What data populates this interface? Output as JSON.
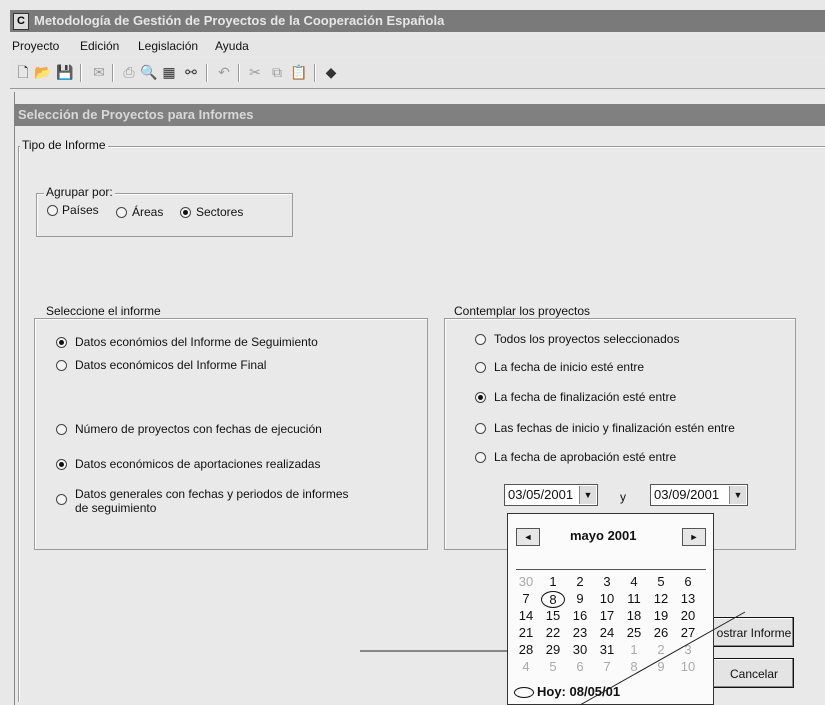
{
  "window": {
    "title": "Metodología de Gestión de Proyectos de la Cooperación Española",
    "icon": "app-icon-C"
  },
  "menu": [
    "Proyecto",
    "Edición",
    "Legislación",
    "Ayuda"
  ],
  "toolbar": {
    "icons": [
      "new-doc-icon",
      "open-folder-icon",
      "save-icon",
      "mail-icon",
      "print-icon",
      "print-preview-icon",
      "calendar-icon",
      "binoculars-icon",
      "undo-icon",
      "cut-icon",
      "copy-icon",
      "paste-icon",
      "book-icon"
    ]
  },
  "subwindow": {
    "title": "Selección de Proyectos para Informes"
  },
  "tipo": {
    "legend": "Tipo de Informe"
  },
  "agrupar": {
    "legend": "Agrupar por:",
    "options": [
      {
        "label": "Países",
        "checked": false
      },
      {
        "label": "Áreas",
        "checked": false
      },
      {
        "label": "Sectores",
        "checked": true
      }
    ]
  },
  "informe": {
    "legend": "Seleccione el informe",
    "options": [
      {
        "label": "Datos económios del Informe de Seguimiento",
        "checked": true
      },
      {
        "label": "Datos económicos del Informe Final",
        "checked": false
      },
      {
        "label": "Número de proyectos con fechas de ejecución",
        "checked": false
      },
      {
        "label": "Datos económicos de aportaciones realizadas",
        "checked": true
      },
      {
        "label": "Datos generales con fechas y periodos de informes",
        "label2": "de seguimiento",
        "checked": false
      }
    ]
  },
  "contemplar": {
    "legend": "Contemplar los proyectos",
    "options": [
      {
        "label": "Todos los proyectos seleccionados",
        "checked": false
      },
      {
        "label": "La fecha de inicio esté entre",
        "checked": false
      },
      {
        "label": "La fecha de finalización esté entre",
        "checked": true
      },
      {
        "label": "Las fechas de inicio y finalización estén entre",
        "checked": false
      },
      {
        "label": "La fecha de aprobación esté entre",
        "checked": false
      }
    ],
    "date_from": "03/05/2001",
    "between": "y",
    "date_to": "03/09/2001"
  },
  "calendar": {
    "month": "mayo 2001",
    "prev": "◄",
    "next": "►",
    "weeks": [
      [
        "30",
        "1",
        "2",
        "3",
        "4",
        "5",
        "6"
      ],
      [
        "7",
        "8",
        "9",
        "10",
        "11",
        "12",
        "13"
      ],
      [
        "14",
        "15",
        "16",
        "17",
        "18",
        "19",
        "20"
      ],
      [
        "21",
        "22",
        "23",
        "24",
        "25",
        "26",
        "27"
      ],
      [
        "28",
        "29",
        "30",
        "31",
        "1",
        "2",
        "3"
      ],
      [
        "4",
        "5",
        "6",
        "7",
        "8",
        "9",
        "10"
      ]
    ],
    "today": "Hoy: 08/05/01"
  },
  "buttons": {
    "mostrar": "ostrar Informe",
    "cancelar": "Cancelar"
  }
}
